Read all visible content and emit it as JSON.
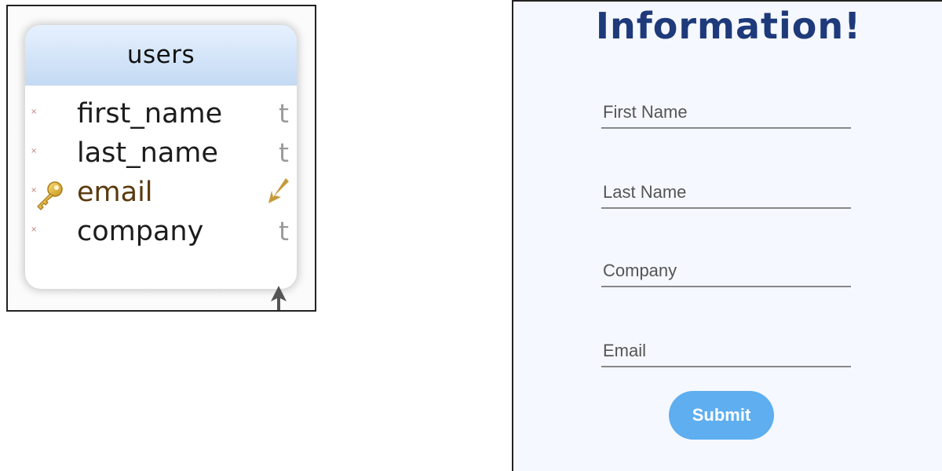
{
  "schema_table": {
    "title": "users",
    "columns": [
      {
        "name": "first_name",
        "type": "t",
        "primary_key": false,
        "foreign_key": false,
        "marker": "×"
      },
      {
        "name": "last_name",
        "type": "t",
        "primary_key": false,
        "foreign_key": false,
        "marker": "×"
      },
      {
        "name": "email",
        "type": "",
        "primary_key": true,
        "foreign_key": true,
        "marker": "×",
        "icon": "key-icon"
      },
      {
        "name": "company",
        "type": "t",
        "primary_key": false,
        "foreign_key": false,
        "marker": "×"
      }
    ],
    "colors": {
      "header_top": "#e6f1ff",
      "header_bottom": "#c4daf3",
      "primary_key_text": "#5a3a0e"
    }
  },
  "form": {
    "title": "Information!",
    "fields": [
      {
        "placeholder": "First Name",
        "value": ""
      },
      {
        "placeholder": "Last Name",
        "value": ""
      },
      {
        "placeholder": "Company",
        "value": ""
      },
      {
        "placeholder": "Email",
        "value": ""
      }
    ],
    "submit_label": "Submit",
    "colors": {
      "title": "#1e3a7a",
      "button": "#5eaef0",
      "background": "#f5f8ff"
    }
  }
}
